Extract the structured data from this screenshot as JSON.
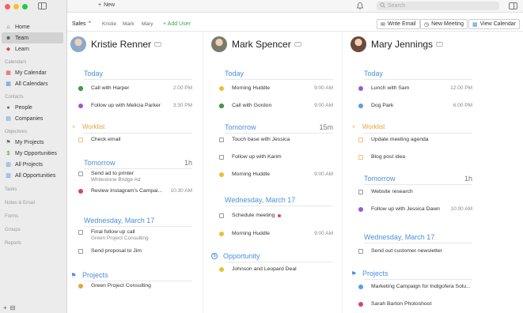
{
  "sidebar": {
    "items": [
      {
        "label": "Home",
        "icon": "home-icon",
        "glyph": "⌂",
        "color": "#555"
      },
      {
        "label": "Team",
        "icon": "team-icon",
        "glyph": "☻",
        "color": "#555",
        "active": true
      },
      {
        "label": "Learn",
        "icon": "learn-icon",
        "glyph": "◆",
        "color": "#e04848"
      }
    ],
    "sections": [
      {
        "title": "Calendars",
        "items": [
          {
            "label": "My Calendar",
            "icon": "calendar-icon",
            "glyph": "▦",
            "color": "#e04848"
          },
          {
            "label": "All Calendars",
            "icon": "calendars-icon",
            "glyph": "▦",
            "color": "#4a90d9"
          }
        ]
      },
      {
        "title": "Contacts",
        "items": [
          {
            "label": "People",
            "icon": "people-icon",
            "glyph": "●",
            "color": "#666"
          },
          {
            "label": "Companies",
            "icon": "companies-icon",
            "glyph": "▤",
            "color": "#4a90d9"
          }
        ]
      },
      {
        "title": "Objectives",
        "items": [
          {
            "label": "My Projects",
            "icon": "my-projects-icon",
            "glyph": "⚑",
            "color": "#666"
          },
          {
            "label": "My Opportunities",
            "icon": "my-opportunities-icon",
            "glyph": "$",
            "color": "#3da54a"
          },
          {
            "label": "All Projects",
            "icon": "all-projects-icon",
            "glyph": "▥",
            "color": "#4a90d9"
          },
          {
            "label": "All Opportunities",
            "icon": "all-opportunities-icon",
            "glyph": "▥",
            "color": "#4a90d9"
          }
        ]
      }
    ],
    "footer_sections": [
      "Tasks",
      "Notes & Email",
      "Forms",
      "Groups",
      "Reports"
    ],
    "bottom_icons": [
      "+",
      "⊟"
    ]
  },
  "topbar": {
    "new_label": "New",
    "search_placeholder": "Search"
  },
  "filterbar": {
    "selected": "Sales",
    "names": [
      "Kristie",
      "Mark",
      "Mary"
    ],
    "add_user": "+ Add User",
    "buttons": [
      {
        "label": "Write Email",
        "icon": "email-icon",
        "glyph": "✉"
      },
      {
        "label": "New Meeting",
        "icon": "meeting-icon",
        "glyph": "◷"
      },
      {
        "label": "View Calendar",
        "icon": "view-calendar-icon",
        "glyph": "▦"
      }
    ]
  },
  "columns": [
    {
      "name": "Kristie Renner",
      "avatar_color": "#8fa9c8",
      "sections": [
        {
          "title": "Today",
          "style": "blue",
          "items": [
            {
              "label": "Call with Harper",
              "time": "2:00 PM",
              "type": "dot",
              "color": "#3da54a"
            },
            {
              "label": "Follow up with Melicia Parker",
              "time": "3:30 PM",
              "type": "dot",
              "color": "#9b59d0"
            }
          ]
        },
        {
          "title": "Worklist",
          "style": "orange",
          "items": [
            {
              "label": "Check email",
              "type": "check-orange"
            }
          ]
        },
        {
          "title": "Tomorrow",
          "badge": "1h",
          "style": "blue",
          "items": [
            {
              "label": "Send ad to printer",
              "sub": "Whitestone Bridge Ad",
              "type": "check"
            },
            {
              "label": "Review Instagram's Campai...",
              "time": "10:30 AM",
              "type": "dot",
              "color": "#d9436b"
            }
          ]
        },
        {
          "title": "Wednesday, March 17",
          "style": "blue",
          "items": [
            {
              "label": "Final follow up call",
              "sub": "Green Project Consulting",
              "type": "check"
            },
            {
              "label": "Send proposal to Jim",
              "type": "check"
            }
          ]
        },
        {
          "title": "Projects",
          "style": "blue-icon",
          "items": [
            {
              "label": "Green Project Consulting",
              "type": "dot",
              "color": "#e8a33c"
            }
          ]
        }
      ]
    },
    {
      "name": "Mark Spencer",
      "avatar_color": "#7a7a6a",
      "sections": [
        {
          "title": "Today",
          "style": "blue",
          "items": [
            {
              "label": "Morning Huddle",
              "time": "9:00 AM",
              "type": "dot",
              "color": "#e8c030"
            },
            {
              "label": "Call with Gordon",
              "time": "9:00 AM",
              "type": "dot",
              "color": "#3da54a"
            }
          ]
        },
        {
          "title": "Tomorrow",
          "badge": "15m",
          "style": "blue",
          "items": [
            {
              "label": "Touch base with Jessica",
              "type": "check"
            },
            {
              "label": "Follow up with Karim",
              "type": "check"
            },
            {
              "label": "Morning Huddle",
              "time": "9:00 AM",
              "type": "dot",
              "color": "#e8c030"
            }
          ]
        },
        {
          "title": "Wednesday, March 17",
          "style": "blue",
          "items": [
            {
              "label": "Schedule meeting",
              "type": "check",
              "flag": "#d9436b"
            },
            {
              "label": "Morning Huddle",
              "time": "9:00 AM",
              "type": "dot",
              "color": "#e8c030"
            }
          ]
        },
        {
          "title": "Opportunity",
          "style": "blue-icon",
          "items": [
            {
              "label": "Johnson and Leopard Deal",
              "type": "dot",
              "color": "#e8c030"
            }
          ]
        }
      ]
    },
    {
      "name": "Mary Jennings",
      "avatar_color": "#6b4a3a",
      "sections": [
        {
          "title": "Today",
          "style": "blue",
          "items": [
            {
              "label": "Lunch with Sam",
              "time": "12:00 PM",
              "type": "dot",
              "color": "#9b59d0"
            },
            {
              "label": "Dog Park",
              "time": "6:00 PM",
              "type": "dot",
              "color": "#5aa0d9"
            }
          ]
        },
        {
          "title": "Worklist",
          "style": "orange",
          "items": [
            {
              "label": "Update meeting agenda",
              "type": "check-orange"
            },
            {
              "label": "Blog post idea",
              "type": "check-orange"
            }
          ]
        },
        {
          "title": "Tomorrow",
          "badge": "1h",
          "style": "blue",
          "items": [
            {
              "label": "Website research",
              "type": "check"
            },
            {
              "label": "Follow up with Jessica Dawn",
              "time": "10:00 AM",
              "type": "dot",
              "color": "#9b59d0"
            }
          ]
        },
        {
          "title": "Wednesday, March 17",
          "style": "blue",
          "items": [
            {
              "label": "Send out customer newsletter",
              "type": "check"
            }
          ]
        },
        {
          "title": "Projects",
          "style": "blue-icon",
          "items": [
            {
              "label": "Marketing Campaign for Indigofera Solu...",
              "type": "dot",
              "color": "#5aa0d9"
            },
            {
              "label": "Sarah Barton Photoshoot",
              "type": "dot",
              "color": "#d9436b"
            }
          ]
        }
      ]
    }
  ]
}
